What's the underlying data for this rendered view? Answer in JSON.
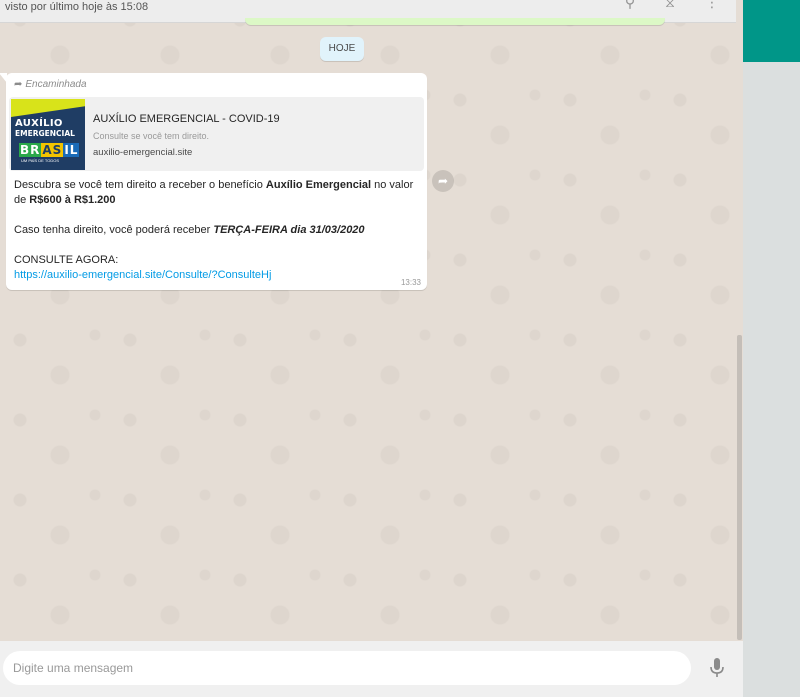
{
  "header": {
    "last_seen": "visto por último hoje às 15:08"
  },
  "date_badge": "HOJE",
  "message": {
    "forwarded_label": "Encaminhada",
    "preview": {
      "thumb_title_line1": "AUXÍLIO",
      "thumb_title_line2": "EMERGENCIAL",
      "thumb_brand": [
        "BR",
        "AS",
        "IL"
      ],
      "thumb_sub": "UM PAÍS DE TODOS",
      "title": "AUXÍLIO EMERGENCIAL - COVID-19",
      "description": "Consulte se você tem direito.",
      "domain": "auxilio-emergencial.site"
    },
    "line1_pre": "Descubra se você tem direito a receber o benefício ",
    "line1_bold": "Auxílio Emergencial",
    "line1_post": " no valor de ",
    "line1_bold2": "R$600 à R$1.200",
    "line2_pre": "Caso tenha direito, você poderá receber ",
    "line2_bold_italic": "TERÇA-FEIRA dia 31/03/2020",
    "line3": "CONSULTE AGORA:",
    "link": "https://auxilio-emergencial.site/Consulte/?ConsulteHj",
    "time": "13:33"
  },
  "compose": {
    "placeholder": "Digite uma mensagem"
  },
  "colors": {
    "teal": "#009688",
    "chat_bg": "#e5ddd5",
    "link": "#039be5"
  }
}
